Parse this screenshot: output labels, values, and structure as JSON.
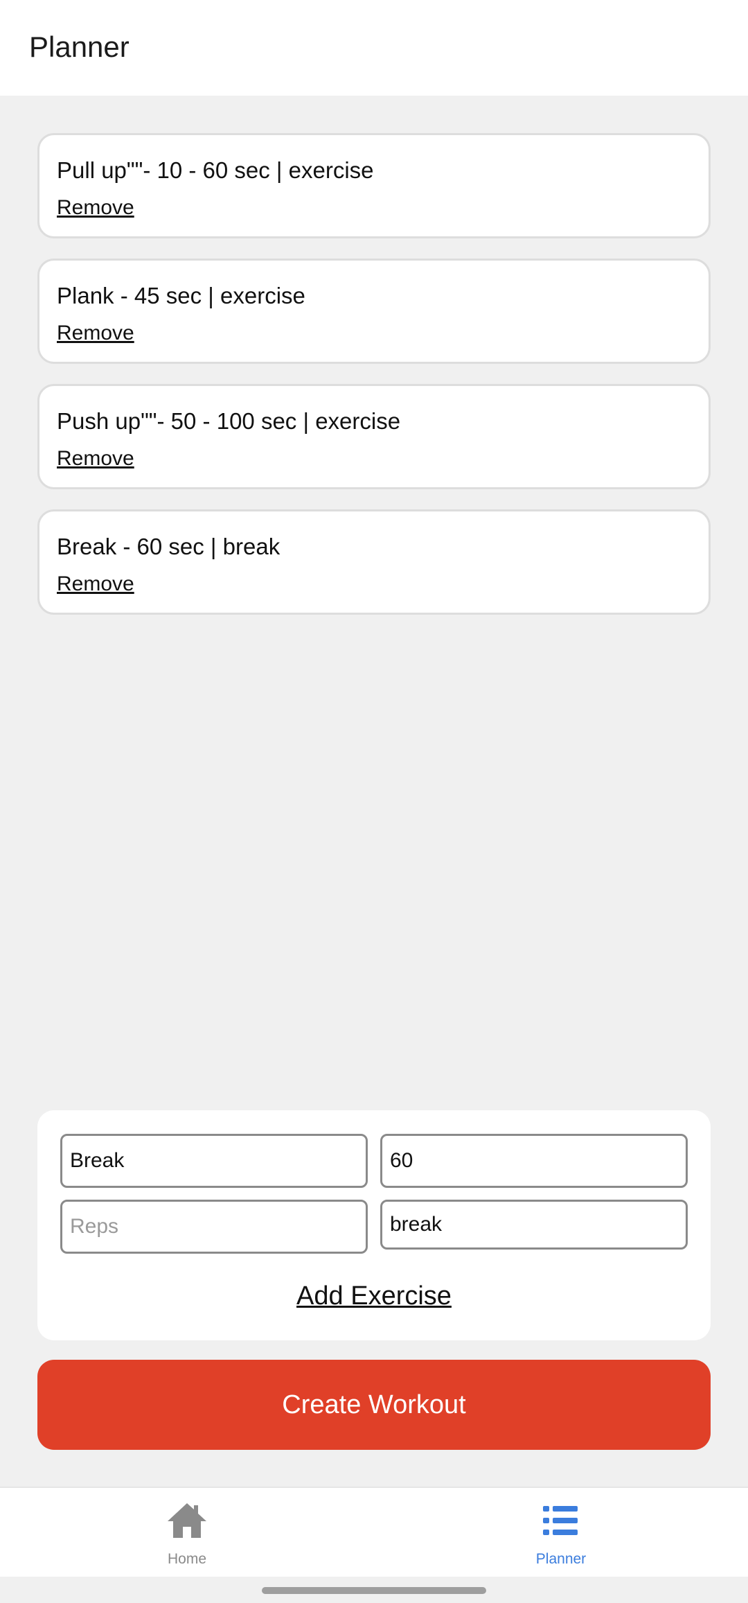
{
  "header": {
    "title": "Planner"
  },
  "plan": {
    "items": [
      {
        "text": "Pull up\"\"- 10 - 60 sec | exercise",
        "remove_label": "Remove"
      },
      {
        "text": "Plank - 45 sec | exercise",
        "remove_label": "Remove"
      },
      {
        "text": "Push up\"\"- 50 - 100 sec | exercise",
        "remove_label": "Remove"
      },
      {
        "text": "Break - 60 sec | break",
        "remove_label": "Remove"
      }
    ]
  },
  "form": {
    "name": {
      "value": "Break"
    },
    "duration": {
      "value": "60"
    },
    "reps": {
      "value": "",
      "placeholder": "Reps"
    },
    "type": {
      "value": "break"
    },
    "add_label": "Add Exercise"
  },
  "create_label": "Create Workout",
  "tabbar": {
    "home": {
      "label": "Home",
      "icon": "home-icon",
      "color": "#8a8a8a"
    },
    "planner": {
      "label": "Planner",
      "icon": "list-icon",
      "color": "#3b7ddd",
      "active": true
    }
  },
  "colors": {
    "accent": "#e04028",
    "active_tab": "#3b7ddd",
    "inactive_tab": "#8a8a8a",
    "background": "#f0f0f0"
  }
}
